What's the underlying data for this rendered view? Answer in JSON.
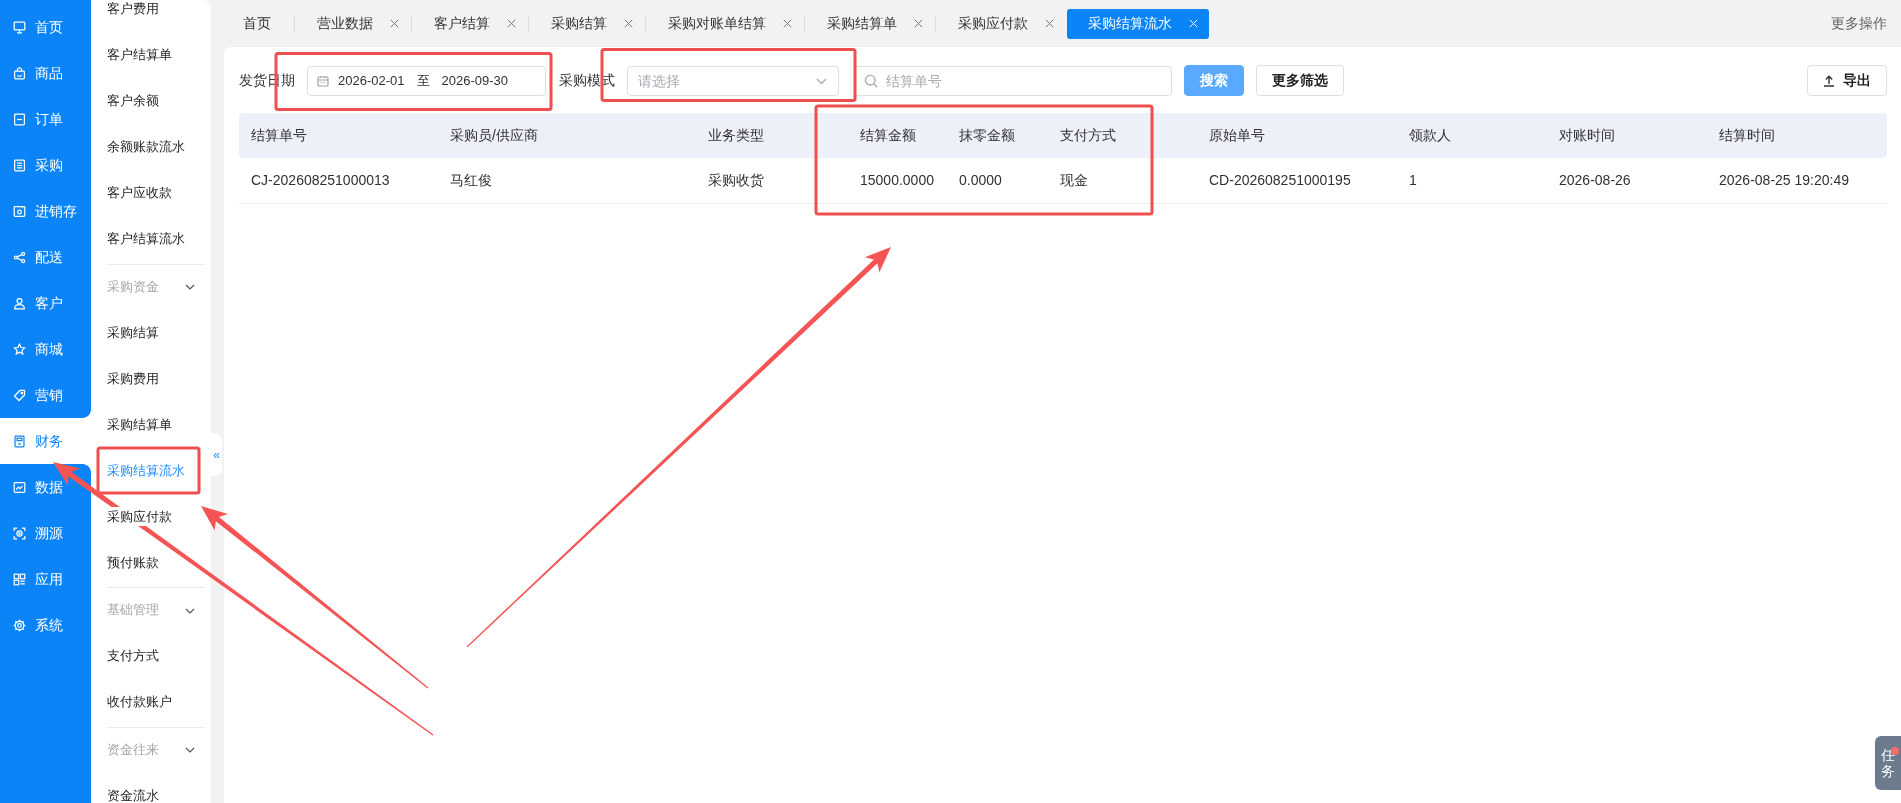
{
  "sidebar": {
    "items": [
      {
        "label": "首页",
        "selected": false
      },
      {
        "label": "商品",
        "selected": false
      },
      {
        "label": "订单",
        "selected": false
      },
      {
        "label": "采购",
        "selected": false
      },
      {
        "label": "进销存",
        "selected": false
      },
      {
        "label": "配送",
        "selected": false
      },
      {
        "label": "客户",
        "selected": false
      },
      {
        "label": "商城",
        "selected": false
      },
      {
        "label": "营销",
        "selected": false
      },
      {
        "label": "财务",
        "selected": true
      },
      {
        "label": "数据",
        "selected": false
      },
      {
        "label": "溯源",
        "selected": false
      },
      {
        "label": "应用",
        "selected": false
      },
      {
        "label": "系统",
        "selected": false
      }
    ]
  },
  "submenu": {
    "items": [
      {
        "kind": "item",
        "label": "客户费用",
        "selected": false,
        "highlighted": false
      },
      {
        "kind": "item",
        "label": "客户结算单",
        "selected": false,
        "highlighted": false
      },
      {
        "kind": "item",
        "label": "客户余额",
        "selected": false,
        "highlighted": false
      },
      {
        "kind": "item",
        "label": "余额账款流水",
        "selected": false,
        "highlighted": false
      },
      {
        "kind": "item",
        "label": "客户应收款",
        "selected": false,
        "highlighted": false
      },
      {
        "kind": "item",
        "label": "客户结算流水",
        "selected": false,
        "highlighted": false
      },
      {
        "kind": "group",
        "label": "采购资金"
      },
      {
        "kind": "item",
        "label": "采购结算",
        "selected": false,
        "highlighted": false
      },
      {
        "kind": "item",
        "label": "采购费用",
        "selected": false,
        "highlighted": false
      },
      {
        "kind": "item",
        "label": "采购结算单",
        "selected": false,
        "highlighted": false
      },
      {
        "kind": "item",
        "label": "采购结算流水",
        "selected": true,
        "highlighted": true
      },
      {
        "kind": "item",
        "label": "采购应付款",
        "selected": false,
        "highlighted": false
      },
      {
        "kind": "item",
        "label": "预付账款",
        "selected": false,
        "highlighted": false
      },
      {
        "kind": "group",
        "label": "基础管理"
      },
      {
        "kind": "item",
        "label": "支付方式",
        "selected": false,
        "highlighted": false
      },
      {
        "kind": "item",
        "label": "收付款账户",
        "selected": false,
        "highlighted": false
      },
      {
        "kind": "group",
        "label": "资金往来"
      },
      {
        "kind": "item",
        "label": "资金流水",
        "selected": false,
        "highlighted": false
      }
    ],
    "collapse_toggle": "«"
  },
  "tabs": [
    {
      "label": "首页",
      "closable": false,
      "selected": false
    },
    {
      "label": "营业数据",
      "closable": true,
      "selected": false
    },
    {
      "label": "客户结算",
      "closable": true,
      "selected": false
    },
    {
      "label": "采购结算",
      "closable": true,
      "selected": false
    },
    {
      "label": "采购对账单结算",
      "closable": true,
      "selected": false
    },
    {
      "label": "采购结算单",
      "closable": true,
      "selected": false
    },
    {
      "label": "采购应付款",
      "closable": true,
      "selected": false
    },
    {
      "label": "采购结算流水",
      "closable": true,
      "selected": true
    }
  ],
  "more_actions": "更多操作",
  "filters": {
    "date": {
      "label": "发货日期",
      "start": "2026-02-01",
      "separator": "至",
      "end": "2026-09-30",
      "highlighted": true
    },
    "mode": {
      "label": "采购模式",
      "placeholder": "请选择",
      "highlighted": true
    },
    "search": {
      "placeholder": "结算单号"
    },
    "buttons": [
      {
        "kind": "primary",
        "label": "搜索"
      },
      {
        "kind": "default",
        "label": "更多筛选"
      }
    ],
    "export_button": "导出"
  },
  "table": {
    "columns": [
      {
        "label": "结算单号",
        "highlighted": false
      },
      {
        "label": "采购员/供应商",
        "highlighted": false
      },
      {
        "label": "业务类型",
        "highlighted": false
      },
      {
        "label": "结算金额",
        "highlighted": true
      },
      {
        "label": "抹零金额",
        "highlighted": true
      },
      {
        "label": "支付方式",
        "highlighted": true
      },
      {
        "label": "原始单号",
        "highlighted": false
      },
      {
        "label": "领款人",
        "highlighted": false
      },
      {
        "label": "对账时间",
        "highlighted": false
      },
      {
        "label": "结算时间",
        "highlighted": false
      }
    ],
    "rows": [
      [
        "CJ-202608251000013",
        "马红俊",
        "采购收货",
        "15000.0000",
        "0.0000",
        "现金",
        "CD-202608251000195",
        "1",
        "2026-08-26",
        "2026-08-25 19:20:49"
      ]
    ]
  },
  "task_button": {
    "label": "任务",
    "unread": true
  },
  "annotations": [
    {
      "kind": "arrow"
    },
    {
      "kind": "arrow"
    },
    {
      "kind": "arrow"
    }
  ]
}
